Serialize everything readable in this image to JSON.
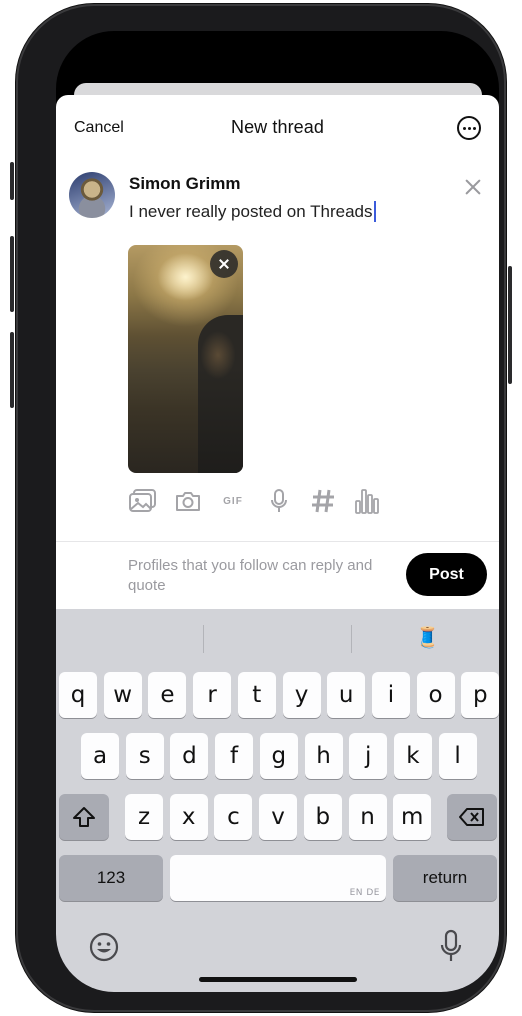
{
  "compose": {
    "cancel": "Cancel",
    "title": "New thread",
    "username": "Simon Grimm",
    "post_text": "I never really posted on Threads",
    "reply_hint": "Profiles that you follow can reply and quote",
    "post_button": "Post"
  },
  "attachments": [
    "image-icon",
    "camera-icon",
    "gif-icon",
    "microphone-icon",
    "hashtag-icon",
    "poll-icon"
  ],
  "attachment_gif_label": "GIF",
  "keyboard": {
    "row1": [
      "q",
      "w",
      "e",
      "r",
      "t",
      "y",
      "u",
      "i",
      "o",
      "p"
    ],
    "row2": [
      "a",
      "s",
      "d",
      "f",
      "g",
      "h",
      "j",
      "k",
      "l"
    ],
    "row3": [
      "z",
      "x",
      "c",
      "v",
      "b",
      "n",
      "m"
    ],
    "numbers": "123",
    "space_languages": "EN DE",
    "return": "return",
    "suggestion_emoji": "🧵"
  },
  "colors": {
    "caret": "#3b5bdb",
    "post_button_bg": "#000000",
    "keyboard_bg": "#d2d3d8"
  }
}
